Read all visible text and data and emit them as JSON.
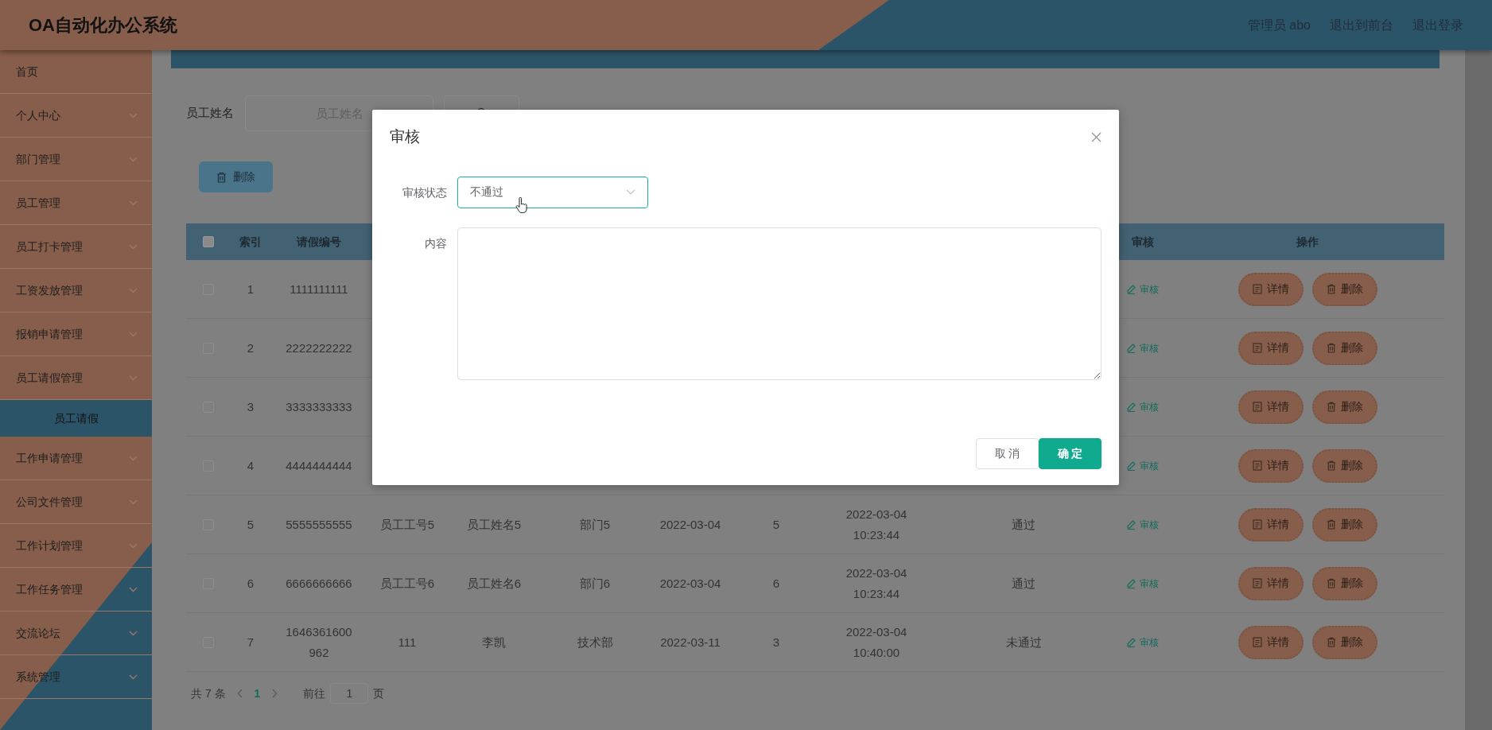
{
  "header": {
    "title": "OA自动化办公系统",
    "links": [
      {
        "label": "管理员 abo"
      },
      {
        "label": "退出到前台"
      },
      {
        "label": "退出登录"
      }
    ]
  },
  "sidebar": {
    "items": [
      {
        "label": "首页",
        "expandable": false
      },
      {
        "label": "个人中心",
        "expandable": true
      },
      {
        "label": "部门管理",
        "expandable": true
      },
      {
        "label": "员工管理",
        "expandable": true
      },
      {
        "label": "员工打卡管理",
        "expandable": true
      },
      {
        "label": "工资发放管理",
        "expandable": true
      },
      {
        "label": "报销申请管理",
        "expandable": true
      },
      {
        "label": "员工请假管理",
        "expandable": true,
        "children": [
          {
            "label": "员工请假",
            "selected": true
          }
        ]
      },
      {
        "label": "工作申请管理",
        "expandable": true
      },
      {
        "label": "公司文件管理",
        "expandable": true
      },
      {
        "label": "工作计划管理",
        "expandable": true
      },
      {
        "label": "工作任务管理",
        "expandable": true
      },
      {
        "label": "交流论坛",
        "expandable": true
      },
      {
        "label": "系统管理",
        "expandable": true
      }
    ]
  },
  "search": {
    "label": "员工姓名",
    "placeholder": "员工姓名"
  },
  "toolbar": {
    "delete_label": "删除"
  },
  "table": {
    "select_all_checked": false,
    "headers": {
      "index": "索引",
      "leave_no": "请假编号",
      "review": "审核",
      "actions": "操作"
    },
    "rows": [
      {
        "checked": false,
        "index": "1",
        "leave_no": "1111111111",
        "review_link": "审核",
        "detail_button": "详情",
        "delete_button": "删除"
      },
      {
        "checked": false,
        "index": "2",
        "leave_no": "2222222222",
        "review_link": "审核",
        "detail_button": "详情",
        "delete_button": "删除"
      },
      {
        "checked": false,
        "index": "3",
        "leave_no": "3333333333",
        "review_link": "审核",
        "detail_button": "详情",
        "delete_button": "删除"
      },
      {
        "checked": false,
        "index": "4",
        "leave_no": "4444444444",
        "review_link": "审核",
        "detail_button": "详情",
        "delete_button": "删除"
      },
      {
        "checked": false,
        "index": "5",
        "leave_no": "5555555555",
        "column_4": "员工工号5",
        "column_5": "员工姓名5",
        "column_6": "部门5",
        "column_7": "2022-03-04",
        "column_8": "5",
        "column_9": "2022-03-04 10:23:44",
        "column_10": "通过",
        "review_link": "审核",
        "detail_button": "详情",
        "delete_button": "删除"
      },
      {
        "checked": false,
        "index": "6",
        "leave_no": "6666666666",
        "column_4": "员工工号6",
        "column_5": "员工姓名6",
        "column_6": "部门6",
        "column_7": "2022-03-04",
        "column_8": "6",
        "column_9": "2022-03-04 10:23:44",
        "column_10": "通过",
        "review_link": "审核",
        "detail_button": "详情",
        "delete_button": "删除"
      },
      {
        "checked": false,
        "index": "7",
        "leave_no": "1646361600962",
        "column_4": "111",
        "column_5": "李凯",
        "column_6": "技术部",
        "column_7": "2022-03-11",
        "column_8": "3",
        "column_9": "2022-03-04 10:40:00",
        "column_10": "未通过",
        "review_link": "审核",
        "detail_button": "详情",
        "delete_button": "删除"
      }
    ]
  },
  "pagination": {
    "total": "共 7 条",
    "pages": [
      {
        "label": "1",
        "selected": true
      }
    ],
    "goto_label": "前往",
    "goto_value": "1",
    "page_suffix": "页"
  },
  "dialog": {
    "title": "审核",
    "fields": [
      {
        "kind": "select",
        "label": "审核状态",
        "value": "不通过",
        "focused": true
      },
      {
        "kind": "textarea",
        "label": "内容"
      }
    ],
    "buttons": [
      {
        "label": "取 消",
        "kind": "secondary"
      },
      {
        "label": "确 定",
        "kind": "primary"
      }
    ]
  }
}
